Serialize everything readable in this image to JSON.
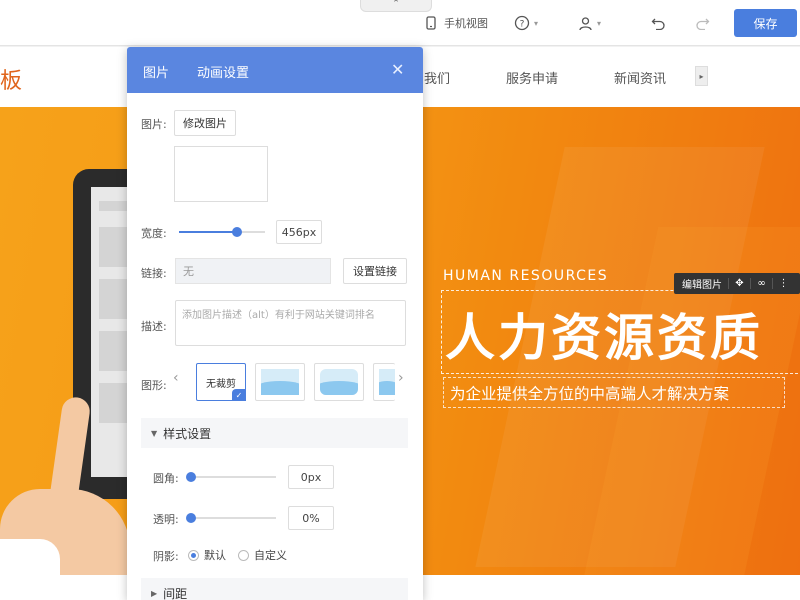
{
  "toolbar": {
    "mobile_view_label": "手机视图",
    "save_label": "保存"
  },
  "site": {
    "logo_text": "板",
    "nav_items": [
      "我们",
      "服务申请",
      "新闻资讯"
    ]
  },
  "banner": {
    "english_heading": "HUMAN RESOURCES",
    "chinese_title": "人力资源资质",
    "subtitle": "为企业提供全方位的中高端人才解决方案",
    "edit_image_label": "编辑图片"
  },
  "panel": {
    "tabs": [
      "图片",
      "动画设置"
    ],
    "image_label": "图片:",
    "change_image_button": "修改图片",
    "width_label": "宽度:",
    "width_value": "456px",
    "width_fraction": 0.68,
    "link_label": "链接:",
    "link_value": "无",
    "set_link_button": "设置链接",
    "desc_label": "描述:",
    "desc_placeholder": "添加图片描述（alt）有利于网站关键词排名",
    "shape_label": "图形:",
    "shape_options": [
      "无裁剪"
    ],
    "style_section_label": "样式设置",
    "radius_label": "圆角:",
    "radius_value": "0px",
    "opacity_label": "透明:",
    "opacity_value": "0%",
    "shadow_label": "阴影:",
    "shadow_options": [
      "默认",
      "自定义"
    ],
    "spacing_section_label": "间距"
  },
  "colors": {
    "accent": "#4a7ede",
    "panel_header": "#5a86e0",
    "banner_orange": "#f28a10"
  }
}
